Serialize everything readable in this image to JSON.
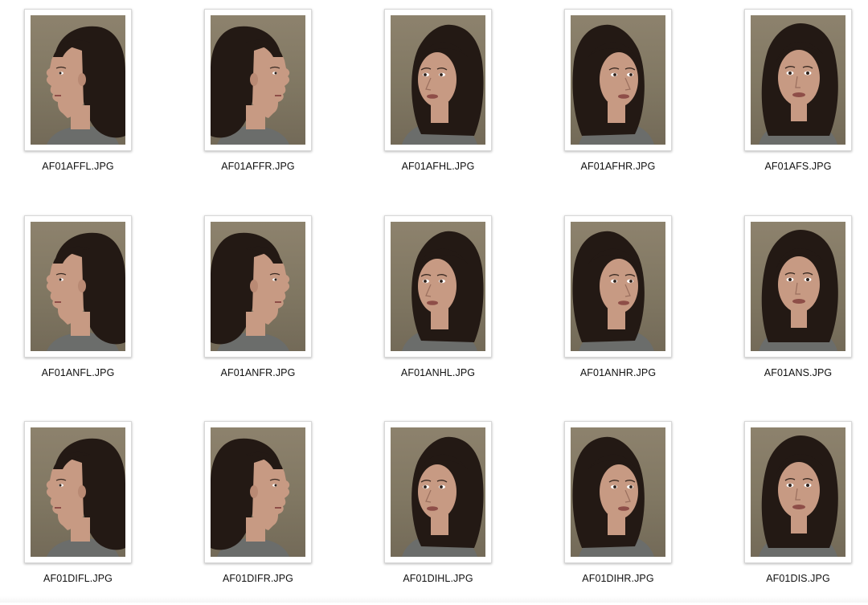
{
  "files": [
    {
      "name": "AF01AFFL.JPG",
      "pose": "left"
    },
    {
      "name": "AF01AFFR.JPG",
      "pose": "right"
    },
    {
      "name": "AF01AFHL.JPG",
      "pose": "half-left"
    },
    {
      "name": "AF01AFHR.JPG",
      "pose": "half-right"
    },
    {
      "name": "AF01AFS.JPG",
      "pose": "front"
    },
    {
      "name": "AF01ANFL.JPG",
      "pose": "left"
    },
    {
      "name": "AF01ANFR.JPG",
      "pose": "right"
    },
    {
      "name": "AF01ANHL.JPG",
      "pose": "half-left"
    },
    {
      "name": "AF01ANHR.JPG",
      "pose": "half-right"
    },
    {
      "name": "AF01ANS.JPG",
      "pose": "front"
    },
    {
      "name": "AF01DIFL.JPG",
      "pose": "left"
    },
    {
      "name": "AF01DIFR.JPG",
      "pose": "right"
    },
    {
      "name": "AF01DIHL.JPG",
      "pose": "half-left"
    },
    {
      "name": "AF01DIHR.JPG",
      "pose": "half-right"
    },
    {
      "name": "AF01DIS.JPG",
      "pose": "front"
    }
  ],
  "colors": {
    "background": "#ffffff",
    "photo_backdrop": "#857b66",
    "hair": "#231914",
    "skin": "#c79a83",
    "shirt": "#6b6d6b"
  }
}
